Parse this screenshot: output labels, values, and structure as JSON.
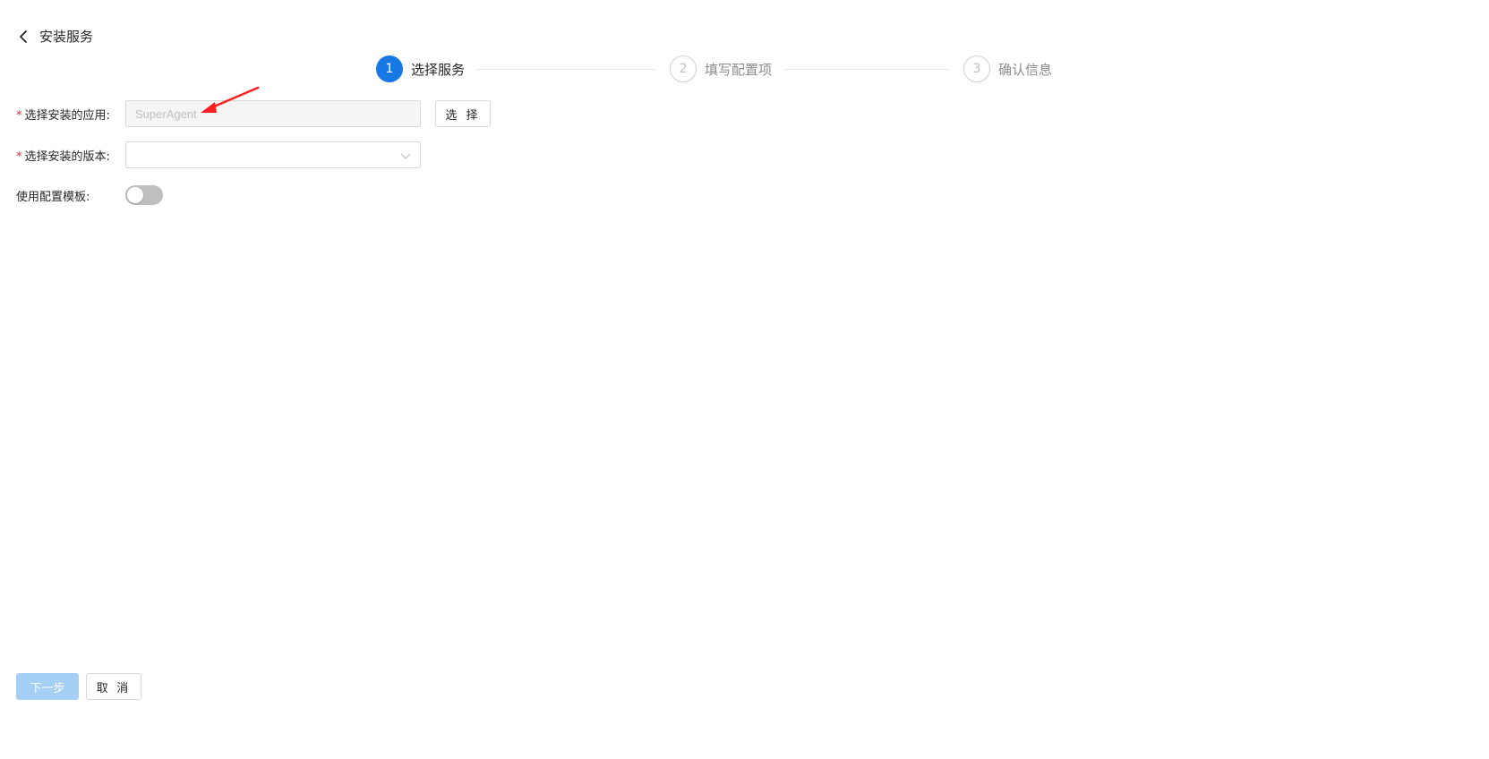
{
  "header": {
    "back_icon": "chevron-left-icon",
    "title": "安装服务"
  },
  "steps": [
    {
      "number": "1",
      "label": "选择服务",
      "status": "active"
    },
    {
      "number": "2",
      "label": "填写配置项",
      "status": "wait"
    },
    {
      "number": "3",
      "label": "确认信息",
      "status": "wait"
    }
  ],
  "form": {
    "app": {
      "required_mark": "*",
      "label": "选择安装的应用:",
      "value": "SuperAgent",
      "select_button": "选 择"
    },
    "version": {
      "required_mark": "*",
      "label": "选择安装的版本:",
      "value": ""
    },
    "template": {
      "label": "使用配置模板:",
      "enabled": false
    }
  },
  "footer": {
    "next_label": "下一步",
    "cancel_label": "取 消"
  },
  "colors": {
    "primary": "#1677e5",
    "required": "#f5222d",
    "annotation_arrow": "#ff1f1f"
  }
}
